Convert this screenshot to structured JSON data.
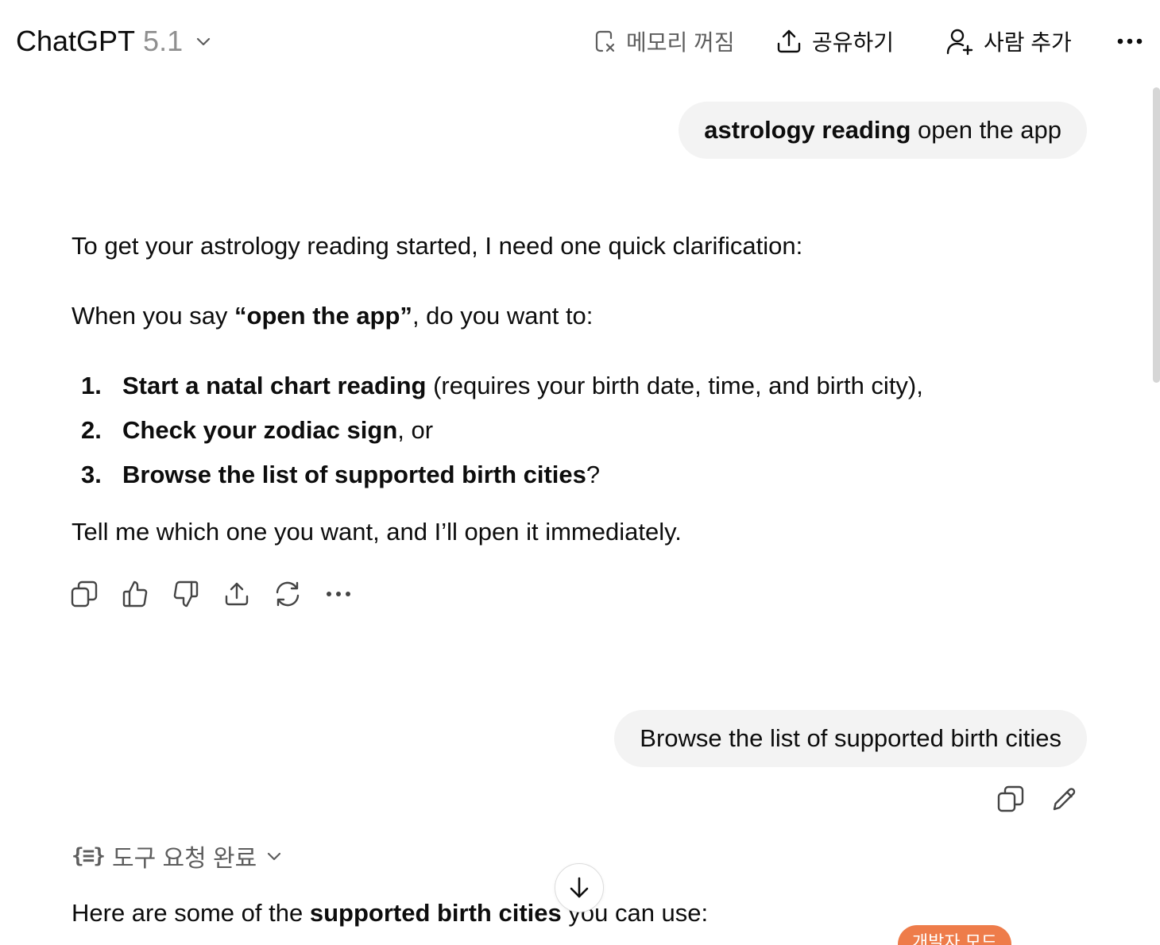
{
  "header": {
    "model_name": "ChatGPT",
    "model_version": "5.1",
    "memory_label": "메모리 꺼짐",
    "share_label": "공유하기",
    "add_person_label": "사람 추가"
  },
  "messages": {
    "user_1": {
      "bold": "astrology reading",
      "rest": " open the app"
    },
    "assistant_1": {
      "intro": "To get your astrology reading started, I need one quick clarification:",
      "question_prefix": "When you say ",
      "question_bold": "“open the app”",
      "question_suffix": ", do you want to:",
      "options": [
        {
          "num": "1.",
          "bold": "Start a natal chart reading",
          "rest": " (requires your birth date, time, and birth city),"
        },
        {
          "num": "2.",
          "bold": "Check your zodiac sign",
          "rest": ", or"
        },
        {
          "num": "3.",
          "bold": "Browse the list of supported birth cities",
          "rest": "?"
        }
      ],
      "closing": "Tell me which one you want, and I’ll open it immediately."
    },
    "user_2": {
      "text": "Browse the list of supported birth cities"
    },
    "tool_status": {
      "icon": "{≡}",
      "label": "도구 요청 완료"
    },
    "assistant_2": {
      "prefix": "Here are some of the ",
      "bold": "supported birth cities",
      "suffix": " you can use:"
    }
  },
  "badge": {
    "dev_mode": "개발자 모드"
  },
  "icons": {
    "model_chevron": "chevron-down-icon",
    "memory": "memory-off-icon",
    "share": "upload-icon",
    "add_person": "user-plus-icon",
    "more": "ellipsis-icon",
    "copy": "copy-icon",
    "thumbs_up": "thumbs-up-icon",
    "thumbs_down": "thumbs-down-icon",
    "regenerate": "refresh-icon",
    "edit": "pencil-icon",
    "scroll_down": "arrow-down-icon"
  },
  "colors": {
    "bubble_bg": "#f3f3f3",
    "muted_text": "#8f8f8f",
    "dev_badge": "#ee7c4a"
  }
}
